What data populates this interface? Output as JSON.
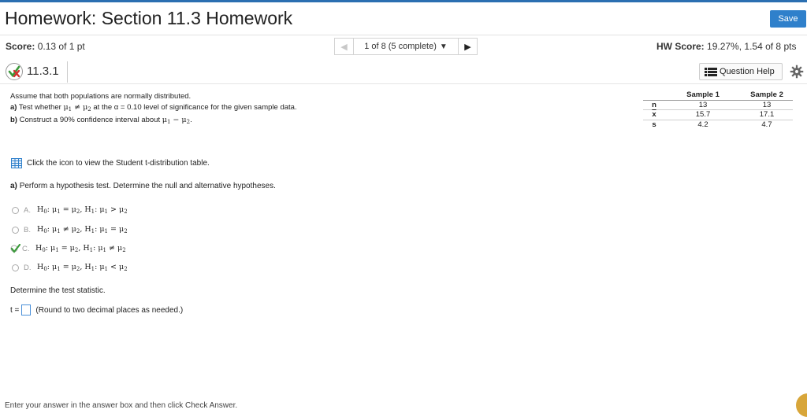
{
  "header": {
    "title": "Homework: Section 11.3 Homework",
    "save_label": "Save",
    "score_label": "Score:",
    "score_value": "0.13 of 1 pt",
    "pager_info": "1 of 8 (5 complete)",
    "hw_score_label": "HW Score:",
    "hw_score_value": "19.27%, 1.54 of 8 pts"
  },
  "question": {
    "id": "11.3.1",
    "help_label": "Question Help",
    "intro": "Assume that both populations are normally distributed.",
    "part_a_label": "a)",
    "part_a_pre": "Test whether",
    "part_a_post": "at the α = 0.10 level of significance for the given sample data.",
    "part_b_label": "b)",
    "part_b_pre": "Construct a 90% confidence interval about"
  },
  "sample_table": {
    "headers": [
      "",
      "Sample 1",
      "Sample 2"
    ],
    "rows": [
      {
        "label": "n",
        "s1": "13",
        "s2": "13"
      },
      {
        "label": "x",
        "s1": "15.7",
        "s2": "17.1"
      },
      {
        "label": "s",
        "s1": "4.2",
        "s2": "4.7"
      }
    ]
  },
  "tlink": "Click the icon to view the Student t-distribution table.",
  "hypothesis": {
    "label": "a)",
    "prompt": "Perform a hypothesis test. Determine the null and alternative hypotheses.",
    "options": [
      {
        "letter": "A.",
        "h1_op": ">",
        "h0_op": "="
      },
      {
        "letter": "B.",
        "h0_op": "≠",
        "h1_op": "="
      },
      {
        "letter": "C.",
        "h0_op": "=",
        "h1_op": "≠"
      },
      {
        "letter": "D.",
        "h0_op": "=",
        "h1_op": "<"
      }
    ]
  },
  "test_stat": {
    "prompt": "Determine the test statistic.",
    "var": "t =",
    "hint": "(Round to two decimal places as needed.)"
  },
  "footer_cutoff": "Enter your answer in the answer box and then click Check Answer.",
  "colors": {
    "accent": "#2f80cb",
    "correct_check": "#3a9a3a",
    "incorrect_mark": "#d0312d"
  }
}
